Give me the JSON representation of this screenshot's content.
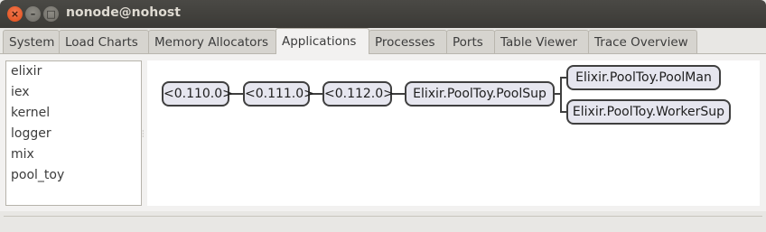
{
  "window": {
    "title": "nonode@nohost"
  },
  "tabs": [
    {
      "label": "System"
    },
    {
      "label": "Load Charts"
    },
    {
      "label": "Memory Allocators"
    },
    {
      "label": "Applications"
    },
    {
      "label": "Processes"
    },
    {
      "label": "Ports"
    },
    {
      "label": "Table Viewer"
    },
    {
      "label": "Trace Overview"
    }
  ],
  "active_tab": "Applications",
  "applications": [
    "elixir",
    "iex",
    "kernel",
    "logger",
    "mix",
    "pool_toy"
  ],
  "process_tree": {
    "nodes": [
      "<0.110.0>",
      "<0.111.0>",
      "<0.112.0>",
      "Elixir.PoolToy.PoolSup",
      "Elixir.PoolToy.PoolMan",
      "Elixir.PoolToy.WorkerSup"
    ]
  }
}
